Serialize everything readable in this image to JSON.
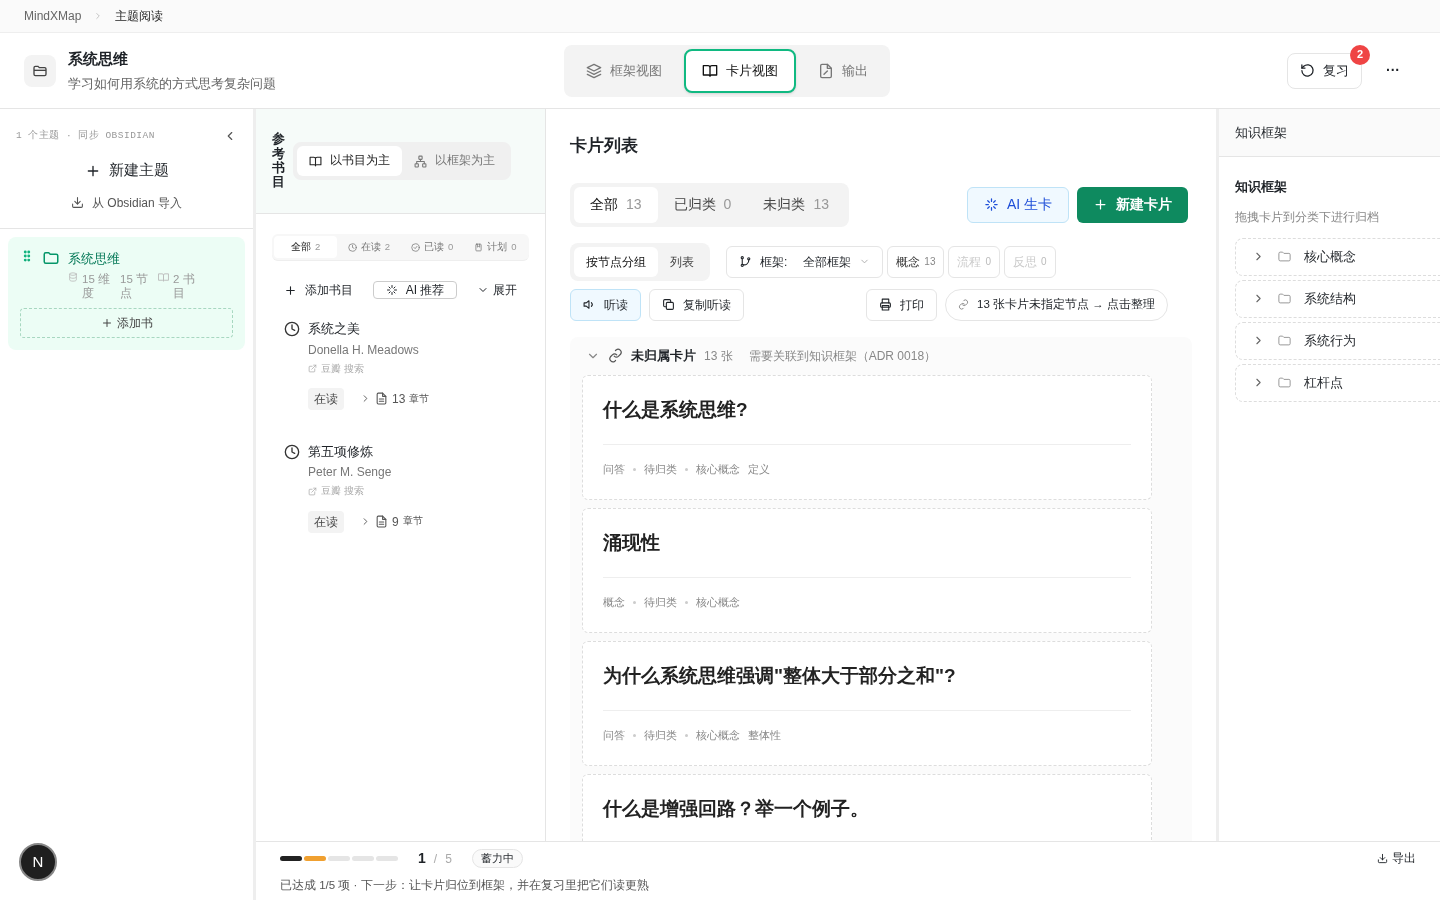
{
  "breadcrumb": [
    "MindXMap",
    "主题阅读"
  ],
  "topic": {
    "title": "系统思维",
    "subtitle": "学习如何用系统的方式思考复杂问题"
  },
  "view_tabs": [
    {
      "label": "框架视图",
      "selected": false
    },
    {
      "label": "卡片视图",
      "selected": true
    },
    {
      "label": "输出",
      "selected": false
    }
  ],
  "review_button": {
    "label": "复习",
    "badge": "2"
  },
  "more_button": "···",
  "sidebar": {
    "meta": "1 个主题 · 同步 OBSIDIAN",
    "new_topic": "新建主题",
    "import": "从 Obsidian 导入",
    "topics": [
      {
        "title": "系统思维",
        "selected": true,
        "dimensions": "15 维度",
        "nodes": "15 节点",
        "books": "2 书目",
        "add_book": "添加书"
      }
    ],
    "avatar": "N"
  },
  "books": {
    "heading": "参考书目",
    "mode_toggle": [
      {
        "label": "以书目为主",
        "selected": true
      },
      {
        "label": "以框架为主",
        "selected": false
      }
    ],
    "filters": [
      {
        "label": "全部",
        "count": "2",
        "selected": true
      },
      {
        "label": "在读",
        "count": "2",
        "selected": false
      },
      {
        "label": "已读",
        "count": "0",
        "selected": false
      },
      {
        "label": "计划",
        "count": "0",
        "selected": false
      }
    ],
    "add_book": "添加书目",
    "ai_recommend": "AI 推荐",
    "expand": "展开",
    "items": [
      {
        "title": "系统之美",
        "author": "Donella H. Meadows",
        "link": "豆瓣 搜索",
        "status": "在读",
        "chapters": "13",
        "chapters_label": "章节"
      },
      {
        "title": "第五项修炼",
        "author": "Peter M. Senge",
        "link": "豆瓣 搜索",
        "status": "在读",
        "chapters": "9",
        "chapters_label": "章节"
      }
    ]
  },
  "cards": {
    "heading": "卡片列表",
    "tabs": [
      {
        "label": "全部",
        "count": "13",
        "selected": true
      },
      {
        "label": "已归类",
        "count": "0",
        "selected": false
      },
      {
        "label": "未归类",
        "count": "13",
        "selected": false
      }
    ],
    "ai_button": "AI 生卡",
    "new_button": "新建卡片",
    "group_modes": [
      {
        "label": "按节点分组",
        "selected": true
      },
      {
        "label": "列表",
        "selected": false
      }
    ],
    "framework_filter": {
      "label": "框架:",
      "value": "全部框架"
    },
    "type_filters": [
      {
        "label": "概念",
        "count": "13",
        "disabled": false
      },
      {
        "label": "流程",
        "count": "0",
        "disabled": true
      },
      {
        "label": "反思",
        "count": "0",
        "disabled": true
      }
    ],
    "listen_button": "听读",
    "copy_button": "复制听读",
    "print_button": "打印",
    "organize_link": "13 张卡片未指定节点 → 点击整理",
    "group": {
      "title": "未归属卡片",
      "count": "13 张",
      "note": "需要关联到知识框架（ADR 0018）",
      "expanded": true,
      "items": [
        {
          "title": "什么是系统思维?",
          "tags": [
            "问答",
            "待归类",
            "核心概念",
            "定义"
          ]
        },
        {
          "title": "涌现性",
          "tags": [
            "概念",
            "待归类",
            "核心概念"
          ]
        },
        {
          "title": "为什么系统思维强调\"整体大于部分之和\"?",
          "tags": [
            "问答",
            "待归类",
            "核心概念",
            "整体性"
          ]
        },
        {
          "title": "什么是增强回路？举一个例子。"
        }
      ]
    }
  },
  "framework": {
    "panel_title": "知识框架",
    "heading": "知识框架",
    "hint": "拖拽卡片到分类下进行归档",
    "nodes": [
      {
        "label": "核心概念",
        "expanded": false
      },
      {
        "label": "系统结构",
        "expanded": false
      },
      {
        "label": "系统行为",
        "expanded": false
      },
      {
        "label": "杠杆点",
        "expanded": false
      }
    ]
  },
  "footer": {
    "steps": [
      {
        "done": true,
        "current": false
      },
      {
        "done": false,
        "current": true
      },
      {
        "done": false,
        "current": false
      },
      {
        "done": false,
        "current": false
      },
      {
        "done": false,
        "current": false
      }
    ],
    "step": "1",
    "separator": "/",
    "total": "5",
    "badge": "蓄力中",
    "message": "已达成 1/5 项 · 下一步：让卡片归位到框架，并在复习里把它们读更熟",
    "export": "导出"
  }
}
